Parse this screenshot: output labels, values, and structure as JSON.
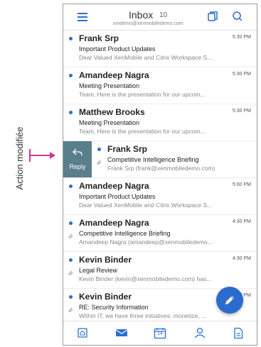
{
  "annotation": {
    "label": "Action modifiée"
  },
  "header": {
    "title": "Inbox",
    "count": "10",
    "account": "xmdemo@xenmobiledemo.com",
    "icons": [
      "menu-icon",
      "copy-icon",
      "search-icon"
    ]
  },
  "swipe_action": {
    "label": "Reply",
    "icon": "reply-icon",
    "color": "#5a7f8c"
  },
  "messages": [
    {
      "sender": "Frank Srp",
      "time": "5:30 PM",
      "subject": "Important Product Updates",
      "preview": "Dear Valued XenMobile and Citrix Workspace S...",
      "unread": true,
      "attachment": false
    },
    {
      "sender": "Amandeep Nagra",
      "time": "5:30 PM",
      "subject": "Meeting Presentation",
      "preview": "Team,     Here is the presentation for our upcom...",
      "unread": true,
      "attachment": false
    },
    {
      "sender": "Matthew Brooks",
      "time": "5:30 PM",
      "subject": "Meeting Presentation",
      "preview": "Team,     Here is the presentation for our upcom...",
      "unread": true,
      "attachment": false
    },
    {
      "sender": "Frank Srp",
      "time": "",
      "subject": "Competitive Intelligence Briefing",
      "preview": "Frank Srp (frank@xenmobiledemo.com)",
      "unread": true,
      "attachment": true
    },
    {
      "sender": "Amandeep Nagra",
      "time": "5:00 PM",
      "subject": "Important Product Updates",
      "preview": "Dear Valued XenMobile and Citrix Workspace S...",
      "unread": true,
      "attachment": false
    },
    {
      "sender": "Amandeep Nagra",
      "time": "4:30 PM",
      "subject": "Competitive Intelligence Briefing",
      "preview": "Amandeep Nagra (amandeep@xenmobiledemo...",
      "unread": true,
      "attachment": true
    },
    {
      "sender": "Kevin Binder",
      "time": "4:30 PM",
      "subject": "Legal Review",
      "preview": "Kevin Binder (kevin@xenmobiledemo.com) has...",
      "unread": true,
      "attachment": true
    },
    {
      "sender": "Kevin Binder",
      "time": "4:30 PM",
      "subject": "RE: Security Information",
      "preview": "Within IT, we have three initiatives: monetize, ...",
      "unread": true,
      "attachment": true
    }
  ],
  "fab": {
    "icon": "compose-icon",
    "color": "#2b6bcf"
  },
  "tabbar": {
    "calendar_date": "14",
    "icons": [
      "home-icon",
      "mail-icon",
      "calendar-icon",
      "people-icon",
      "files-icon"
    ]
  },
  "colors": {
    "accent": "#2a6fcc",
    "annotation": "#d6338a"
  }
}
